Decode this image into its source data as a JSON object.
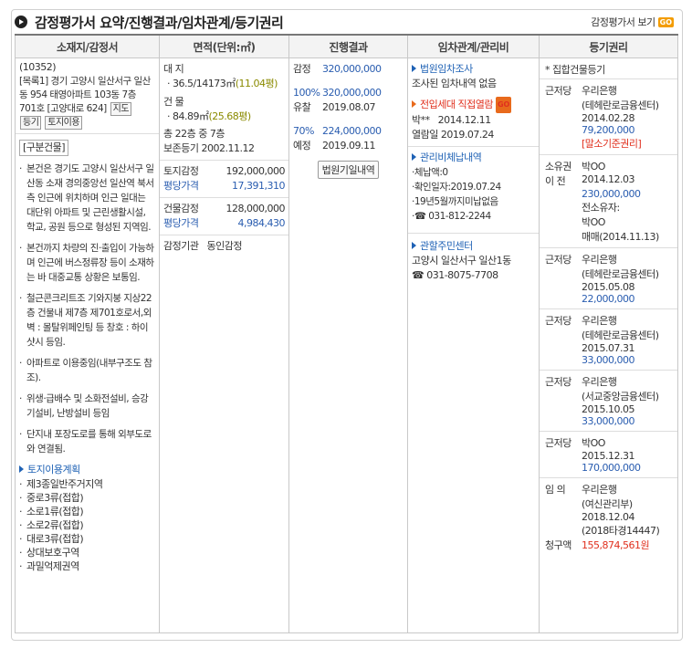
{
  "header": {
    "title": "감정평가서 요약/진행결과/임차관계/등기권리",
    "view_link": "감정평가서 보기",
    "go": "GO"
  },
  "columns": [
    "소재지/감정서",
    "면적(단위:㎡)",
    "진행결과",
    "임차관계/관리비",
    "등기권리"
  ],
  "location": {
    "zip": "(10352)",
    "address": "[목록1] 경기 고양시 일산서구 일산동 954 태영아파트 103동 7층 701호 [고양대로 624]",
    "btn_map": "지도",
    "btn_reg": "등기",
    "btn_land": "토지이용",
    "category": "[구분건물]",
    "bullets": [
      "본건은 경기도 고양시 일산서구 일산동 소재 경의중앙선 일산역 북서측 인근에 위치하며 인근 일대는 대단위 아파트 및 근린생활시설, 학교, 공원 등으로 형성된 지역임.",
      "본건까지 차량의 진·출입이 가능하며 인근에 버스정류장 등이 소재하는 바 대중교통 상황은 보통임.",
      "철근콘크리트조 기와지붕 지상22층 건물내 제7층 제701호로서,외벽 : 몰탈위페인팅 등 창호 : 하이샷시 등임.",
      "아파트로 이용중임(내부구조도 참조).",
      "위생·급배수 및 소화전설비, 승강기설비, 난방설비 등임",
      "단지내 포장도로를 통해 외부도로와 연결됨."
    ],
    "land_plan_title": "토지이용계획",
    "land_plan": [
      "제3종일반주거지역",
      "중로3류(접합)",
      "소로1류(접합)",
      "소로2류(접합)",
      "대로3류(접합)",
      "상대보호구역",
      "과밀억제권역"
    ]
  },
  "area": {
    "land_label": "대 지",
    "land_value": "36.5/14173㎡",
    "land_pyeong": "(11.04평)",
    "bldg_label": "건 물",
    "bldg_value": "84.89㎡",
    "bldg_pyeong": "(25.68평)",
    "floors": "총 22층 중 7층",
    "preserve": "보존등기 2002.11.12",
    "land_appraisal_label": "토지감정",
    "land_appraisal": "192,000,000",
    "land_avg_label": "평당가격",
    "land_avg": "17,391,310",
    "bldg_appraisal_label": "건물감정",
    "bldg_appraisal": "128,000,000",
    "bldg_avg_label": "평당가격",
    "bldg_avg": "4,984,430",
    "appraiser_label": "감정기관",
    "appraiser": "동인감정"
  },
  "progress": {
    "rows": [
      {
        "k": "감정",
        "v": "320,000,000",
        "blue": true
      },
      {
        "k": "100%",
        "v": "320,000,000",
        "blue": true,
        "kblue": true
      },
      {
        "k": "유찰",
        "v": "2019.08.07",
        "blue": false
      },
      {
        "k": "70%",
        "v": "224,000,000",
        "blue": true,
        "kblue": true
      },
      {
        "k": "예정",
        "v": "2019.09.11",
        "blue": false
      }
    ],
    "btn": "법원기일내역"
  },
  "lease": {
    "court_title": "법원임차조사",
    "court_text": "조사된 임차내역 없음",
    "move_title": "전입세대 직접열람",
    "move_go": "GO",
    "move_name": "박**",
    "move_date": "2014.12.11",
    "move_view": "열람일 2019.07.24",
    "mgmt_title": "관리비체납내역",
    "mgmt": [
      "·체납액:0",
      "·확인일자:2019.07.24",
      "·19년5월까지미납없음",
      "·☎ 031-812-2244"
    ],
    "center_title": "관할주민센터",
    "center_addr": "고양시 일산서구 일산1동",
    "center_tel": "☎ 031-8075-7708"
  },
  "registry": {
    "top": "* 집합건물등기",
    "items": [
      {
        "lines": [
          [
            "근저당",
            "우리은행"
          ],
          [
            "",
            "(테헤란로금융센터)"
          ],
          [
            "",
            "2014.02.28"
          ],
          [
            "",
            "79,200,000",
            "blue"
          ],
          [
            "",
            "[말소기준권리]",
            "red"
          ]
        ]
      },
      {
        "lines": [
          [
            "소유권",
            "박OO"
          ],
          [
            "이 전",
            "2014.12.03"
          ],
          [
            "",
            "230,000,000",
            "blue"
          ],
          [
            "",
            "전소유자:"
          ],
          [
            "",
            "박OO"
          ],
          [
            "",
            "매매(2014.11.13)"
          ]
        ]
      },
      {
        "lines": [
          [
            "근저당",
            "우리은행"
          ],
          [
            "",
            "(테헤란로금융센터)"
          ],
          [
            "",
            "2015.05.08"
          ],
          [
            "",
            "22,000,000",
            "blue"
          ]
        ]
      },
      {
        "lines": [
          [
            "근저당",
            "우리은행"
          ],
          [
            "",
            "(테헤란로금융센터)"
          ],
          [
            "",
            "2015.07.31"
          ],
          [
            "",
            "33,000,000",
            "blue"
          ]
        ]
      },
      {
        "lines": [
          [
            "근저당",
            "우리은행"
          ],
          [
            "",
            "(서교중앙금융센터)"
          ],
          [
            "",
            "2015.10.05"
          ],
          [
            "",
            "33,000,000",
            "blue"
          ]
        ]
      },
      {
        "lines": [
          [
            "근저당",
            "박OO"
          ],
          [
            "",
            "2015.12.31"
          ],
          [
            "",
            "170,000,000",
            "blue"
          ]
        ]
      },
      {
        "lines": [
          [
            "임 의",
            "우리은행"
          ],
          [
            "",
            "(여신관리부)"
          ],
          [
            "",
            "2018.12.04"
          ],
          [
            "",
            "(2018타경14447)"
          ],
          [
            "청구액",
            "155,874,561원",
            "red"
          ]
        ]
      }
    ]
  }
}
